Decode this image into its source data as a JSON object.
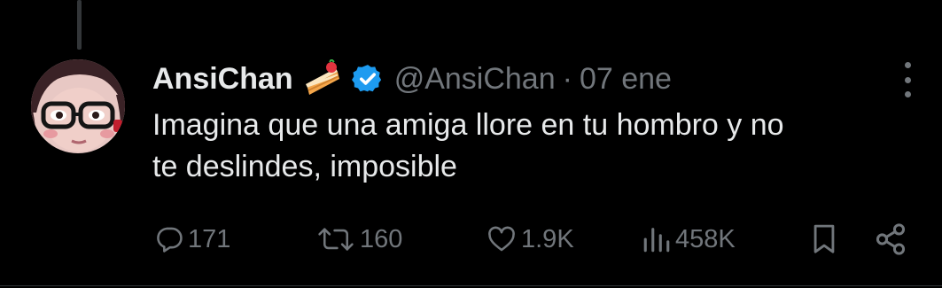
{
  "tweet": {
    "author": {
      "display_name": "AnsiChan",
      "name_emoji": "cake-slice-icon",
      "verified": true,
      "handle": "@AnsiChan",
      "separator": "·",
      "date": "07 ene"
    },
    "text_lines": [
      "Imagina que una amiga llore en tu hombro y no",
      "te deslindes, imposible"
    ],
    "actions": {
      "replies": "171",
      "reposts": "160",
      "likes": "1.9K",
      "views": "458K"
    }
  },
  "icons": {
    "reply": "reply-icon",
    "repost": "repost-icon",
    "like": "heart-icon",
    "views": "views-icon",
    "bookmark": "bookmark-icon",
    "share": "share-icon",
    "more": "more-icon",
    "verified": "verified-badge-icon"
  },
  "colors": {
    "background": "#000000",
    "text_primary": "#e7e9ea",
    "text_secondary": "#71767b",
    "verified_blue": "#1d9bf0",
    "thread_line": "#333639"
  }
}
